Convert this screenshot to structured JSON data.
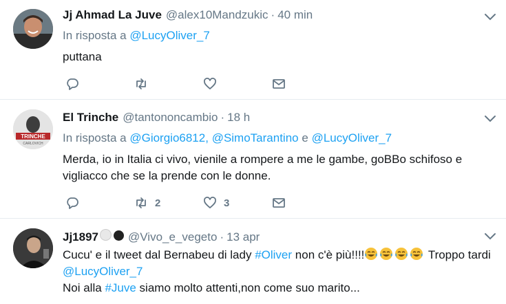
{
  "tweets": [
    {
      "name": "Jj Ahmad La Juve",
      "handle": "@alex10Mandzukic",
      "time": "40 min",
      "reply_prefix": "In risposta a",
      "reply_mentions": [
        "@LucyOliver_7"
      ],
      "text": "puttana"
    },
    {
      "name": "El Trinche",
      "handle": "@tantononcambio",
      "time": "18 h",
      "reply_prefix": "In risposta a",
      "reply_mentions": [
        "@Giorgio6812,",
        "@SimoTarantino",
        "@LucyOliver_7"
      ],
      "reply_and": "e",
      "avatar_text": [
        "TRINCHE",
        "CARLOVICH"
      ],
      "text": "Merda, io in Italia ci vivo, vienile a rompere a me le gambe, goBBo schifoso e vigliacco che se la prende con le donne.",
      "retweets": "2",
      "likes": "3"
    },
    {
      "name": "Jj1897",
      "handle": "@Vivo_e_vegeto",
      "time": "13 apr",
      "text_part1": "Cucu' e il tweet dal Bernabeu di lady",
      "hashtag1": "#Oliver",
      "text_part2": "non c'è più!!!!",
      "text_part3": "Troppo tardi",
      "mention": "@LucyOliver_7",
      "text_part4": "Noi alla",
      "hashtag2": "#Juve",
      "text_part5": "siamo molto attenti,non come suo marito..."
    }
  ],
  "icons": {
    "reply": "reply-icon",
    "retweet": "retweet-icon",
    "like": "heart-icon",
    "dm": "envelope-icon",
    "more": "chevron-down-icon",
    "emoji": "tears-of-joy-emoji"
  },
  "colors": {
    "link": "#1da1f2",
    "muted": "#657786",
    "text": "#14171a",
    "border": "#e6ecf0"
  }
}
